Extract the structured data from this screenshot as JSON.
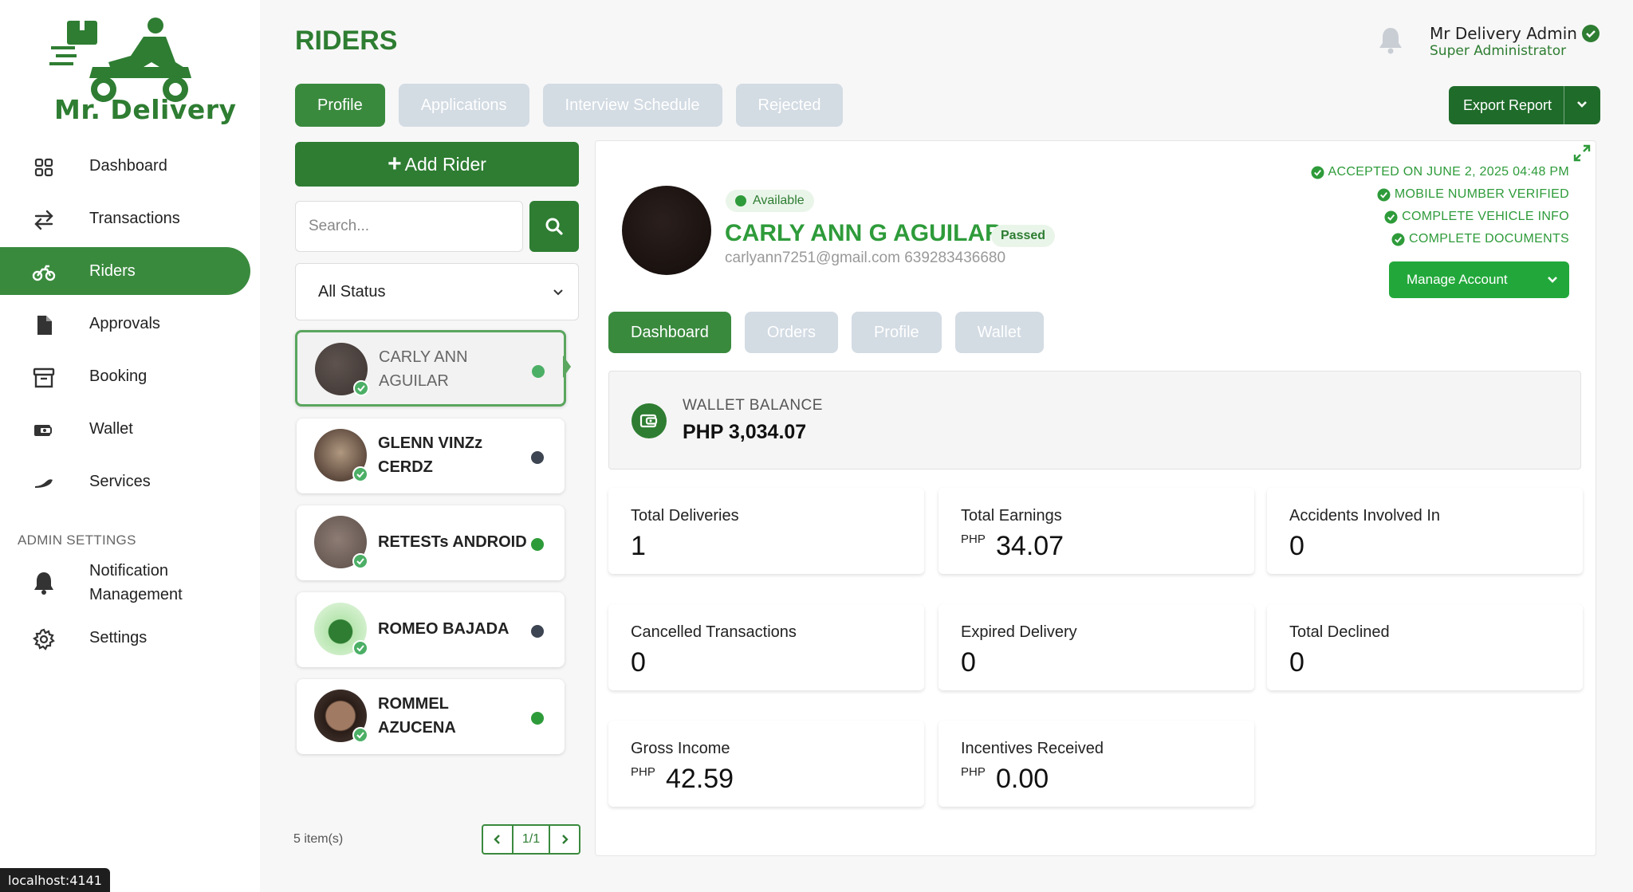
{
  "app": {
    "brand": "Mr. Delivery"
  },
  "sidebar": {
    "items": [
      {
        "label": "Dashboard",
        "icon": "grid-icon",
        "active": false
      },
      {
        "label": "Transactions",
        "icon": "arrows-swap-icon",
        "active": false
      },
      {
        "label": "Riders",
        "icon": "motorcycle-icon",
        "active": true
      },
      {
        "label": "Approvals",
        "icon": "document-icon",
        "active": false
      },
      {
        "label": "Booking",
        "icon": "archive-box-icon",
        "active": false
      },
      {
        "label": "Wallet",
        "icon": "wallet-icon",
        "active": false
      },
      {
        "label": "Services",
        "icon": "services-icon",
        "active": false
      }
    ],
    "admin_heading": "ADMIN SETTINGS",
    "admin_items": [
      {
        "label": "Notification Management",
        "icon": "bell-icon"
      },
      {
        "label": "Settings",
        "icon": "gear-icon"
      }
    ]
  },
  "header": {
    "title": "RIDERS",
    "tabs": [
      {
        "label": "Profile",
        "active": true
      },
      {
        "label": "Applications",
        "active": false
      },
      {
        "label": "Interview Schedule",
        "active": false
      },
      {
        "label": "Rejected",
        "active": false
      }
    ],
    "user_name": "Mr Delivery Admin",
    "user_role": "Super Administrator",
    "export_label": "Export Report"
  },
  "riders_panel": {
    "add_label": "Add Rider",
    "search_placeholder": "Search...",
    "status_filter": "All Status",
    "riders": [
      {
        "name": "CARLY ANN AGUILAR",
        "status_color": "#4caf66",
        "selected": true,
        "avatar_color": "#4a403c"
      },
      {
        "name": "GLENN VINZz CERDZ",
        "status_color": "#3d4552",
        "selected": false,
        "avatar_color": "#8f7a6a"
      },
      {
        "name": "RETESTs ANDROID",
        "status_color": "#2e9b3a",
        "selected": false,
        "avatar_color": "#6e5e58"
      },
      {
        "name": "ROMEO BAJADA",
        "status_color": "#3d4552",
        "selected": false,
        "avatar_color": "#9fd69a"
      },
      {
        "name": "ROMMEL AZUCENA",
        "status_color": "#2e9b3a",
        "selected": false,
        "avatar_color": "#5a3e30"
      }
    ],
    "items_count": "5 item(s)",
    "page": "1/1"
  },
  "profile": {
    "availability": "Available",
    "name": "CARLY ANN G AGUILAR",
    "status_badge": "Passed",
    "contact": "carlyann7251@gmail.com 639283436680",
    "checks": [
      "ACCEPTED ON JUNE 2, 2025 04:48 PM",
      "MOBILE NUMBER VERIFIED",
      "COMPLETE VEHICLE INFO",
      "COMPLETE DOCUMENTS"
    ],
    "manage_label": "Manage Account",
    "tabs": [
      {
        "label": "Dashboard",
        "active": true
      },
      {
        "label": "Orders",
        "active": false
      },
      {
        "label": "Profile",
        "active": false
      },
      {
        "label": "Wallet",
        "active": false
      }
    ],
    "wallet": {
      "label": "WALLET BALANCE",
      "value": "PHP 3,034.07"
    },
    "stats": {
      "total_deliveries": {
        "label": "Total Deliveries",
        "value": "1"
      },
      "total_earnings": {
        "label": "Total Earnings",
        "currency": "PHP",
        "value": "34.07"
      },
      "accidents": {
        "label": "Accidents Involved In",
        "value": "0"
      },
      "cancelled": {
        "label": "Cancelled Transactions",
        "value": "0"
      },
      "expired": {
        "label": "Expired Delivery",
        "value": "0"
      },
      "declined": {
        "label": "Total Declined",
        "value": "0"
      },
      "gross_income": {
        "label": "Gross Income",
        "currency": "PHP",
        "value": "42.59"
      },
      "incentives": {
        "label": "Incentives Received",
        "currency": "PHP",
        "value": "0.00"
      }
    }
  },
  "statusbar": {
    "url": "localhost:4141"
  },
  "colors": {
    "brand_green": "#2e7d32",
    "accent_green": "#2e9b3a",
    "inactive_tab": "#d3dbe3"
  }
}
